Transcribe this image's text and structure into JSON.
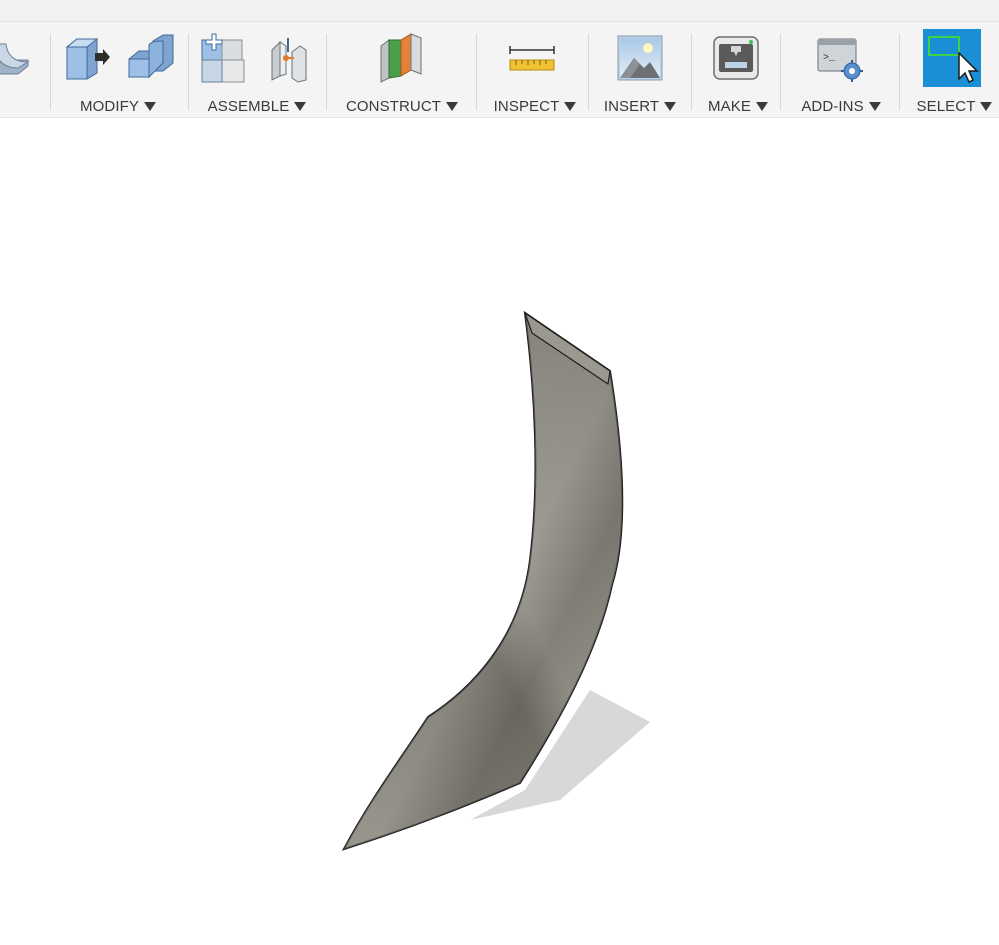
{
  "toolbar": {
    "groups": [
      {
        "label": "MODIFY"
      },
      {
        "label": "ASSEMBLE"
      },
      {
        "label": "CONSTRUCT"
      },
      {
        "label": "INSPECT"
      },
      {
        "label": "INSERT"
      },
      {
        "label": "MAKE"
      },
      {
        "label": "ADD-INS"
      },
      {
        "label": "SELECT"
      }
    ],
    "icons": [
      "sculpt-partial-icon",
      "press-pull-icon",
      "fillet-icon",
      "new-component-icon",
      "joint-icon",
      "offset-plane-icon",
      "measure-icon",
      "insert-image-icon",
      "3d-print-icon",
      "scripts-addins-icon",
      "select-icon"
    ],
    "colors": {
      "active": "#1a8fd6",
      "label": "#3a3a3a",
      "toolbar_bg": "#f4f4f4"
    }
  },
  "viewport": {
    "model": "curved-surface-body",
    "colors": {
      "surface_light": "#a8a59c",
      "surface_dark": "#64625a",
      "shadow": "#d4d4d4"
    }
  }
}
